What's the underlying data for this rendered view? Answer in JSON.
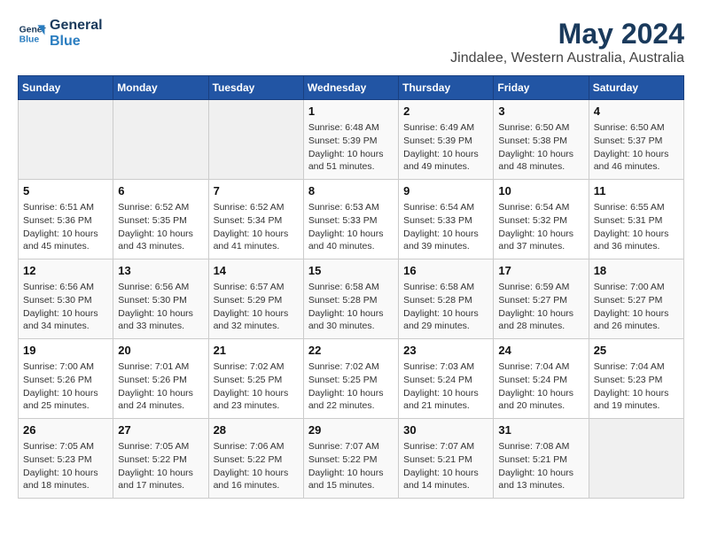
{
  "header": {
    "logo_line1": "General",
    "logo_line2": "Blue",
    "title": "May 2024",
    "subtitle": "Jindalee, Western Australia, Australia"
  },
  "days_of_week": [
    "Sunday",
    "Monday",
    "Tuesday",
    "Wednesday",
    "Thursday",
    "Friday",
    "Saturday"
  ],
  "weeks": [
    [
      {
        "day": "",
        "info": ""
      },
      {
        "day": "",
        "info": ""
      },
      {
        "day": "",
        "info": ""
      },
      {
        "day": "1",
        "info": "Sunrise: 6:48 AM\nSunset: 5:39 PM\nDaylight: 10 hours\nand 51 minutes."
      },
      {
        "day": "2",
        "info": "Sunrise: 6:49 AM\nSunset: 5:39 PM\nDaylight: 10 hours\nand 49 minutes."
      },
      {
        "day": "3",
        "info": "Sunrise: 6:50 AM\nSunset: 5:38 PM\nDaylight: 10 hours\nand 48 minutes."
      },
      {
        "day": "4",
        "info": "Sunrise: 6:50 AM\nSunset: 5:37 PM\nDaylight: 10 hours\nand 46 minutes."
      }
    ],
    [
      {
        "day": "5",
        "info": "Sunrise: 6:51 AM\nSunset: 5:36 PM\nDaylight: 10 hours\nand 45 minutes."
      },
      {
        "day": "6",
        "info": "Sunrise: 6:52 AM\nSunset: 5:35 PM\nDaylight: 10 hours\nand 43 minutes."
      },
      {
        "day": "7",
        "info": "Sunrise: 6:52 AM\nSunset: 5:34 PM\nDaylight: 10 hours\nand 41 minutes."
      },
      {
        "day": "8",
        "info": "Sunrise: 6:53 AM\nSunset: 5:33 PM\nDaylight: 10 hours\nand 40 minutes."
      },
      {
        "day": "9",
        "info": "Sunrise: 6:54 AM\nSunset: 5:33 PM\nDaylight: 10 hours\nand 39 minutes."
      },
      {
        "day": "10",
        "info": "Sunrise: 6:54 AM\nSunset: 5:32 PM\nDaylight: 10 hours\nand 37 minutes."
      },
      {
        "day": "11",
        "info": "Sunrise: 6:55 AM\nSunset: 5:31 PM\nDaylight: 10 hours\nand 36 minutes."
      }
    ],
    [
      {
        "day": "12",
        "info": "Sunrise: 6:56 AM\nSunset: 5:30 PM\nDaylight: 10 hours\nand 34 minutes."
      },
      {
        "day": "13",
        "info": "Sunrise: 6:56 AM\nSunset: 5:30 PM\nDaylight: 10 hours\nand 33 minutes."
      },
      {
        "day": "14",
        "info": "Sunrise: 6:57 AM\nSunset: 5:29 PM\nDaylight: 10 hours\nand 32 minutes."
      },
      {
        "day": "15",
        "info": "Sunrise: 6:58 AM\nSunset: 5:28 PM\nDaylight: 10 hours\nand 30 minutes."
      },
      {
        "day": "16",
        "info": "Sunrise: 6:58 AM\nSunset: 5:28 PM\nDaylight: 10 hours\nand 29 minutes."
      },
      {
        "day": "17",
        "info": "Sunrise: 6:59 AM\nSunset: 5:27 PM\nDaylight: 10 hours\nand 28 minutes."
      },
      {
        "day": "18",
        "info": "Sunrise: 7:00 AM\nSunset: 5:27 PM\nDaylight: 10 hours\nand 26 minutes."
      }
    ],
    [
      {
        "day": "19",
        "info": "Sunrise: 7:00 AM\nSunset: 5:26 PM\nDaylight: 10 hours\nand 25 minutes."
      },
      {
        "day": "20",
        "info": "Sunrise: 7:01 AM\nSunset: 5:26 PM\nDaylight: 10 hours\nand 24 minutes."
      },
      {
        "day": "21",
        "info": "Sunrise: 7:02 AM\nSunset: 5:25 PM\nDaylight: 10 hours\nand 23 minutes."
      },
      {
        "day": "22",
        "info": "Sunrise: 7:02 AM\nSunset: 5:25 PM\nDaylight: 10 hours\nand 22 minutes."
      },
      {
        "day": "23",
        "info": "Sunrise: 7:03 AM\nSunset: 5:24 PM\nDaylight: 10 hours\nand 21 minutes."
      },
      {
        "day": "24",
        "info": "Sunrise: 7:04 AM\nSunset: 5:24 PM\nDaylight: 10 hours\nand 20 minutes."
      },
      {
        "day": "25",
        "info": "Sunrise: 7:04 AM\nSunset: 5:23 PM\nDaylight: 10 hours\nand 19 minutes."
      }
    ],
    [
      {
        "day": "26",
        "info": "Sunrise: 7:05 AM\nSunset: 5:23 PM\nDaylight: 10 hours\nand 18 minutes."
      },
      {
        "day": "27",
        "info": "Sunrise: 7:05 AM\nSunset: 5:22 PM\nDaylight: 10 hours\nand 17 minutes."
      },
      {
        "day": "28",
        "info": "Sunrise: 7:06 AM\nSunset: 5:22 PM\nDaylight: 10 hours\nand 16 minutes."
      },
      {
        "day": "29",
        "info": "Sunrise: 7:07 AM\nSunset: 5:22 PM\nDaylight: 10 hours\nand 15 minutes."
      },
      {
        "day": "30",
        "info": "Sunrise: 7:07 AM\nSunset: 5:21 PM\nDaylight: 10 hours\nand 14 minutes."
      },
      {
        "day": "31",
        "info": "Sunrise: 7:08 AM\nSunset: 5:21 PM\nDaylight: 10 hours\nand 13 minutes."
      },
      {
        "day": "",
        "info": ""
      }
    ]
  ]
}
